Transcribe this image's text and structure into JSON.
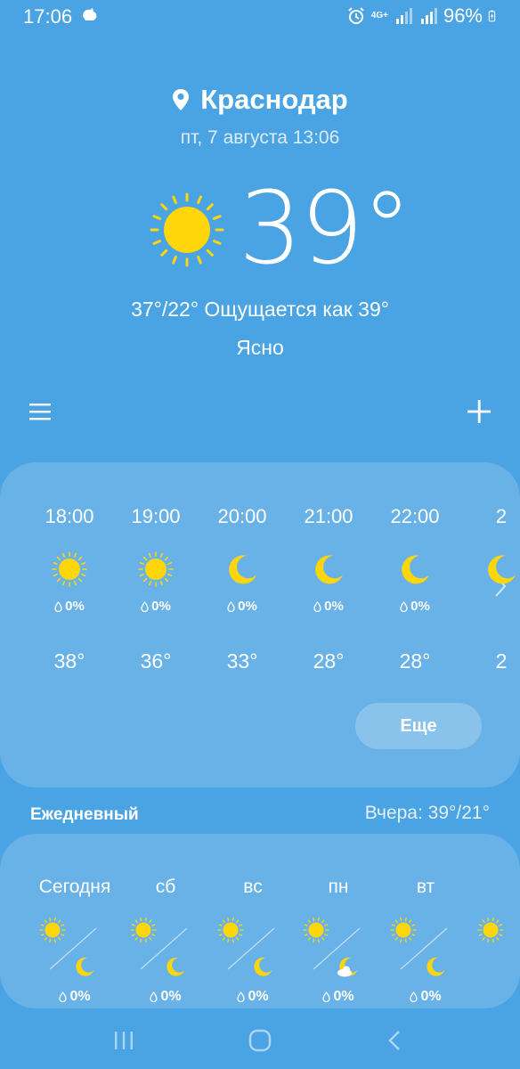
{
  "status": {
    "time": "17:06",
    "network": "4G+",
    "battery": "96%"
  },
  "header": {
    "location": "Краснодар",
    "date": "пт, 7 августа 13:06",
    "temperature": "39°",
    "range_feels": "37°/22° Ощущается как 39°",
    "condition": "Ясно"
  },
  "hourly": [
    {
      "time": "18:00",
      "icon": "sun-icon",
      "precip": "0%",
      "temp": "38°"
    },
    {
      "time": "19:00",
      "icon": "sun-icon",
      "precip": "0%",
      "temp": "36°"
    },
    {
      "time": "20:00",
      "icon": "moon-icon",
      "precip": "0%",
      "temp": "33°"
    },
    {
      "time": "21:00",
      "icon": "moon-icon",
      "precip": "0%",
      "temp": "28°"
    },
    {
      "time": "22:00",
      "icon": "moon-icon",
      "precip": "0%",
      "temp": "28°"
    },
    {
      "time": "2",
      "icon": "moon-icon",
      "precip": "",
      "temp": "2"
    }
  ],
  "more_label": "Еще",
  "daily": {
    "title": "Ежедневный",
    "yesterday": "Вчера: 39°/21°",
    "days": [
      {
        "name": "Сегодня",
        "night_icon": "moon-icon",
        "precip": "0%"
      },
      {
        "name": "сб",
        "night_icon": "moon-icon",
        "precip": "0%"
      },
      {
        "name": "вс",
        "night_icon": "moon-icon",
        "precip": "0%"
      },
      {
        "name": "пн",
        "night_icon": "moon-cloud-icon",
        "precip": "0%"
      },
      {
        "name": "вт",
        "night_icon": "moon-icon",
        "precip": "0%"
      }
    ]
  },
  "colors": {
    "background": "#4aa3e3",
    "sun": "#ffd60a",
    "moon": "#ffd60a"
  }
}
